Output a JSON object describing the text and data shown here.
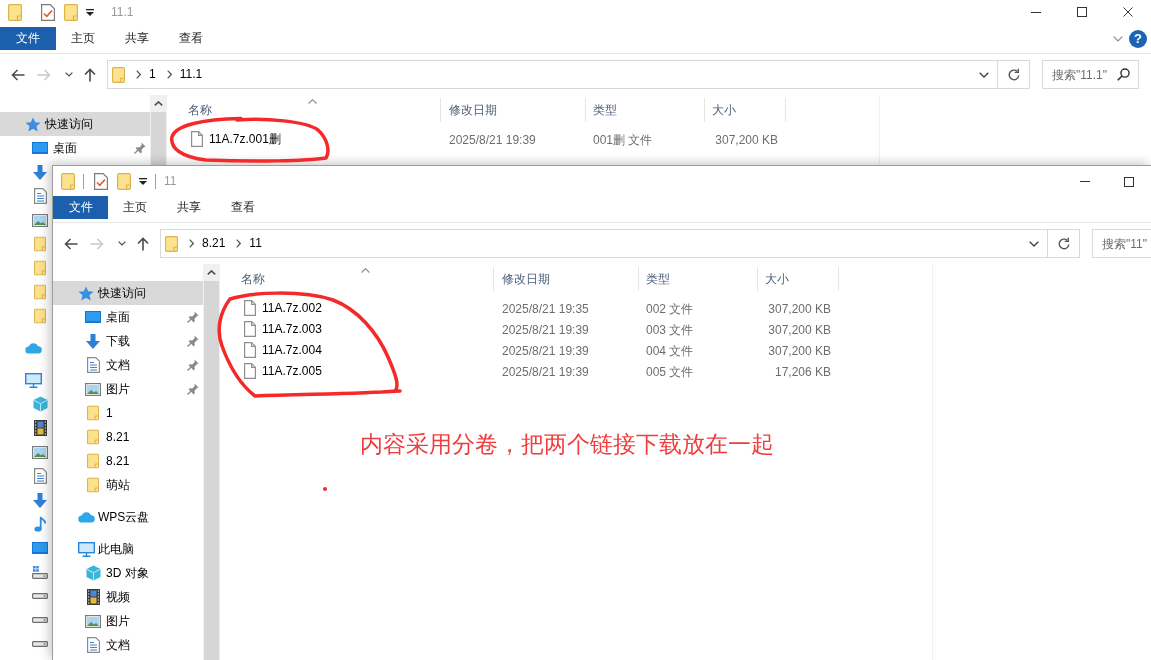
{
  "windows": [
    {
      "kind": "behind",
      "title": "11.1",
      "toolbar_dividers": false,
      "controls": [
        {
          "kind": "minimize"
        },
        {
          "kind": "maximize"
        },
        {
          "kind": "close"
        }
      ],
      "ribbon_tabs": [
        {
          "kind": "file",
          "label": "文件",
          "selected": false
        },
        {
          "kind": "tab",
          "label": "主页",
          "selected": false
        },
        {
          "kind": "tab",
          "label": "共享",
          "selected": false
        },
        {
          "kind": "tab",
          "label": "查看",
          "selected": false
        }
      ],
      "ribbon_toggle": true,
      "help_button": {
        "label": "?"
      },
      "nav": [
        {
          "kind": "back",
          "disabled": false
        },
        {
          "kind": "forward",
          "disabled": true
        },
        {
          "kind": "recent",
          "disabled": false
        },
        {
          "kind": "up",
          "disabled": false
        }
      ],
      "breadcrumbs": [
        "1",
        "11.1"
      ],
      "search": {
        "placeholder": "搜索\"11.1\""
      },
      "sidebar": [
        {
          "kind": "quick-access",
          "label": "快速访问",
          "selected": true,
          "children": [
            {
              "kind": "desktop",
              "label": "桌面",
              "selected": false,
              "pinned": true
            },
            {
              "kind": "download",
              "selected": false
            },
            {
              "kind": "documents",
              "selected": false
            },
            {
              "kind": "pictures",
              "selected": false
            },
            {
              "kind": "folder",
              "selected": false
            },
            {
              "kind": "folder",
              "selected": false
            },
            {
              "kind": "folder",
              "selected": false
            },
            {
              "kind": "folder",
              "selected": false
            }
          ]
        },
        {
          "kind": "cloud",
          "selected": false
        },
        {
          "kind": "pc",
          "selected": false,
          "children": [
            {
              "kind": "cube",
              "selected": false
            },
            {
              "kind": "video",
              "selected": false
            },
            {
              "kind": "pictures",
              "selected": false
            },
            {
              "kind": "documents",
              "selected": false
            },
            {
              "kind": "download",
              "selected": false
            },
            {
              "kind": "music",
              "selected": false
            },
            {
              "kind": "desktop",
              "selected": false
            },
            {
              "kind": "system-drive",
              "selected": false
            },
            {
              "kind": "drive",
              "selected": false
            },
            {
              "kind": "drive",
              "selected": false
            },
            {
              "kind": "drive",
              "selected": false
            }
          ]
        }
      ],
      "columns": [
        {
          "label": "名称",
          "sorted": true
        },
        {
          "label": "修改日期",
          "sorted": false
        },
        {
          "label": "类型",
          "sorted": false
        },
        {
          "label": "大小",
          "sorted": false
        }
      ],
      "files": [
        {
          "name": "11A.7z.001删",
          "modified": "2025/8/21 19:39",
          "type": "001删 文件",
          "size": "307,200 KB"
        }
      ]
    },
    {
      "kind": "front",
      "title": "11",
      "toolbar_dividers": true,
      "controls": [
        {
          "kind": "minimize"
        },
        {
          "kind": "maximize"
        }
      ],
      "ribbon_tabs": [
        {
          "kind": "file",
          "label": "文件",
          "selected": false
        },
        {
          "kind": "tab",
          "label": "主页",
          "selected": false
        },
        {
          "kind": "tab",
          "label": "共享",
          "selected": false
        },
        {
          "kind": "tab",
          "label": "查看",
          "selected": false
        }
      ],
      "nav": [
        {
          "kind": "back",
          "disabled": false
        },
        {
          "kind": "forward",
          "disabled": true
        },
        {
          "kind": "recent",
          "disabled": false
        },
        {
          "kind": "up",
          "disabled": false
        }
      ],
      "breadcrumbs": [
        "8.21",
        "11"
      ],
      "search": {
        "placeholder": "搜索\"11\""
      },
      "sidebar": [
        {
          "kind": "quick-access",
          "label": "快速访问",
          "selected": true,
          "children": [
            {
              "kind": "desktop",
              "label": "桌面",
              "selected": false,
              "pinned": true
            },
            {
              "kind": "download",
              "label": "下载",
              "selected": false,
              "pinned": true
            },
            {
              "kind": "documents",
              "label": "文档",
              "selected": false,
              "pinned": true
            },
            {
              "kind": "pictures",
              "label": "图片",
              "selected": false,
              "pinned": true
            },
            {
              "kind": "folder",
              "label": "1",
              "selected": false,
              "pinned": false
            },
            {
              "kind": "folder",
              "label": "8.21",
              "selected": false,
              "pinned": false
            },
            {
              "kind": "folder",
              "label": "8.21",
              "selected": false,
              "pinned": false
            },
            {
              "kind": "folder",
              "label": "萌站",
              "selected": false,
              "pinned": false
            }
          ]
        },
        {
          "kind": "cloud",
          "label": "WPS云盘",
          "selected": false
        },
        {
          "kind": "pc",
          "label": "此电脑",
          "selected": false,
          "children": [
            {
              "kind": "cube",
              "label": "3D 对象",
              "selected": false
            },
            {
              "kind": "video",
              "label": "视频",
              "selected": false
            },
            {
              "kind": "pictures",
              "label": "图片",
              "selected": false
            },
            {
              "kind": "documents",
              "label": "文档",
              "selected": false
            }
          ]
        }
      ],
      "columns": [
        {
          "label": "名称",
          "sorted": true
        },
        {
          "label": "修改日期",
          "sorted": false
        },
        {
          "label": "类型",
          "sorted": false
        },
        {
          "label": "大小",
          "sorted": false
        }
      ],
      "files": [
        {
          "name": "11A.7z.002",
          "modified": "2025/8/21 19:35",
          "type": "002 文件",
          "size": "307,200 KB"
        },
        {
          "name": "11A.7z.003",
          "modified": "2025/8/21 19:39",
          "type": "003 文件",
          "size": "307,200 KB"
        },
        {
          "name": "11A.7z.004",
          "modified": "2025/8/21 19:39",
          "type": "004 文件",
          "size": "307,200 KB"
        },
        {
          "name": "11A.7z.005",
          "modified": "2025/8/21 19:39",
          "type": "005 文件",
          "size": "17,206 KB"
        }
      ]
    }
  ],
  "annotations": [
    {
      "kind": "loop"
    },
    {
      "kind": "loop"
    },
    {
      "kind": "note",
      "text": "内容采用分卷，把两个链接下载放在一起"
    },
    {
      "kind": "dot"
    }
  ]
}
